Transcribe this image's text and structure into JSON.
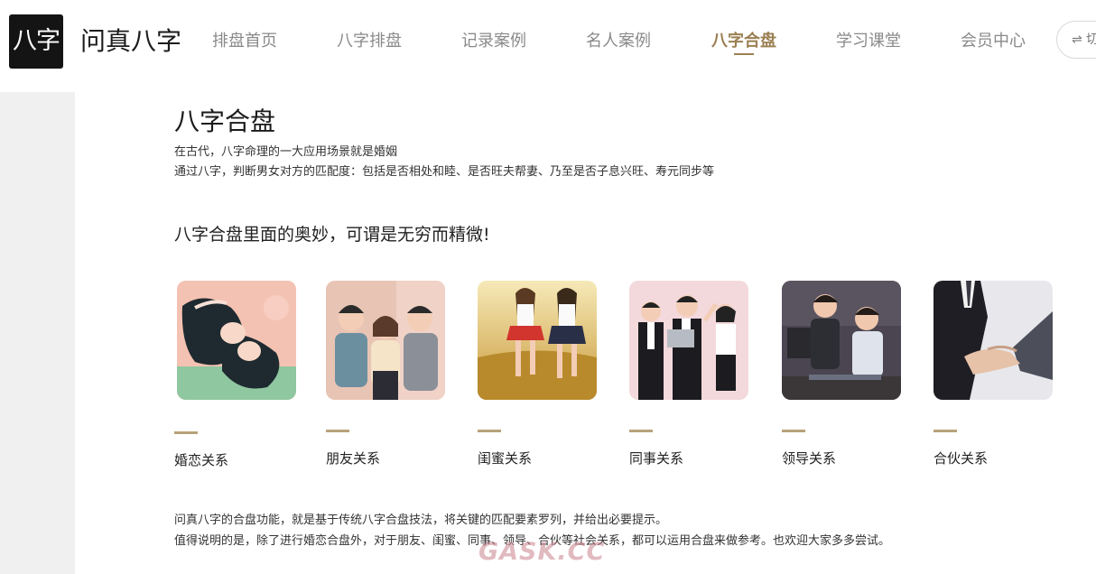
{
  "header": {
    "logo_text": "八字",
    "brand": "问真八字",
    "nav": [
      {
        "label": "排盘首页"
      },
      {
        "label": "八字排盘"
      },
      {
        "label": "记录案例"
      },
      {
        "label": "名人案例"
      },
      {
        "label": "八字合盘",
        "active": true
      },
      {
        "label": "学习课堂"
      },
      {
        "label": "会员中心"
      }
    ],
    "switch_label": "⇌ 切",
    "accent_color": "#9b7f52"
  },
  "main": {
    "title": "八字合盘",
    "subtitle_lines": [
      "在古代，八字命理的一大应用场景就是婚姻",
      "通过八字，判断男女对方的匹配度：包括是否相处和睦、是否旺夫帮妻、乃至是否子息兴旺、寿元同步等"
    ],
    "heading": "八字合盘里面的奥妙，可谓是无穷而精微!",
    "cards": [
      {
        "label": "婚恋关系",
        "image": "couple-lying-illustration"
      },
      {
        "label": "朋友关系",
        "image": "three-friends-illustration"
      },
      {
        "label": "闺蜜关系",
        "image": "two-girls-field-illustration"
      },
      {
        "label": "同事关系",
        "image": "office-colleagues-illustration"
      },
      {
        "label": "领导关系",
        "image": "boss-and-employee-illustration"
      },
      {
        "label": "合伙关系",
        "image": "business-handshake-illustration"
      }
    ],
    "footer_lines": [
      "问真八字的合盘功能，就是基于传统八字合盘技法，将关键的匹配要素罗列，并给出必要提示。",
      "值得说明的是，除了进行婚恋合盘外，对于朋友、闺蜜、同事、领导、合伙等社会关系，都可以运用合盘来做参考。也欢迎大家多多尝试。"
    ]
  },
  "watermark": "GASK.CC"
}
